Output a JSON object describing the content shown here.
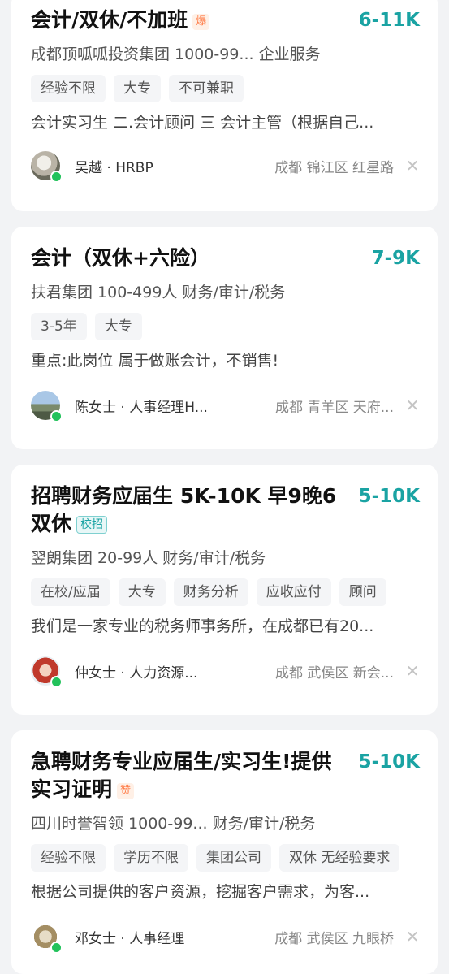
{
  "jobs": [
    {
      "title": "会计/双休/不加班",
      "badge": "爆",
      "salary": "6-11K",
      "company": "成都顶呱呱投资集团  1000-99...  企业服务",
      "tags": [
        "经验不限",
        "大专",
        "不可兼职"
      ],
      "desc": "会计实习生 二.会计顾问 三 会计主管（根据自己...",
      "recruiter": "吴越 · HRBP",
      "location": "成都  锦江区  红星路"
    },
    {
      "title": "会计（双休+六险）",
      "badge": "",
      "salary": "7-9K",
      "company": "扶君集团  100-499人  财务/审计/税务",
      "tags": [
        "3-5年",
        "大专"
      ],
      "desc": "重点:此岗位 属于做账会计，不销售!",
      "recruiter": "陈女士 · 人事经理H...",
      "location": "成都  青羊区  天府..."
    },
    {
      "title": "招聘财务应届生 5K-10K  早9晚6  双休",
      "badge": "校招",
      "salary": "5-10K",
      "company": "翌朗集团  20-99人  财务/审计/税务",
      "tags": [
        "在校/应届",
        "大专",
        "财务分析",
        "应收应付",
        "顾问"
      ],
      "desc": "我们是一家专业的税务师事务所，在成都已有20...",
      "recruiter": "仲女士 · 人力资源...",
      "location": "成都  武侯区  新会..."
    },
    {
      "title": "急聘财务专业应届生/实习生!提供实习证明",
      "badge": "赞",
      "salary": "5-10K",
      "company": "四川时誉智领  1000-99...  财务/审计/税务",
      "tags": [
        "经验不限",
        "学历不限",
        "集团公司",
        "双休 无经验要求"
      ],
      "desc": "根据公司提供的客户资源，挖掘客户需求，为客...",
      "recruiter": "邓女士 · 人事经理",
      "location": "成都  武侯区  九眼桥"
    }
  ],
  "icons": {
    "close": "close-icon",
    "online": "online-dot-icon"
  },
  "colors": {
    "salary": "#1aa3a3",
    "hot_badge": "#ff7a45",
    "online": "#22c25b"
  }
}
